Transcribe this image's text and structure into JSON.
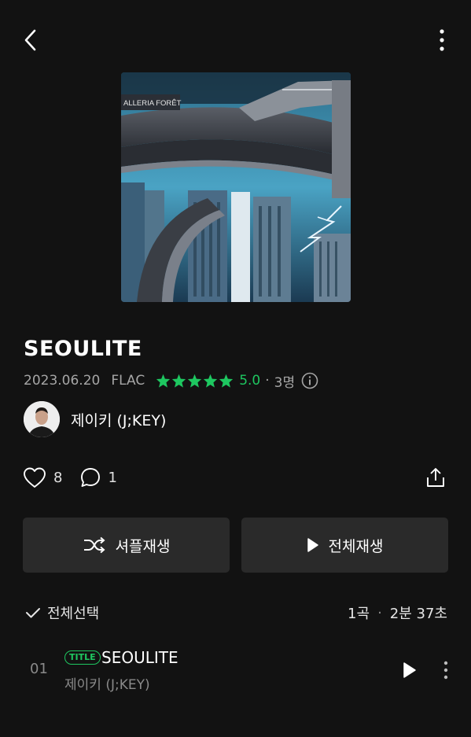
{
  "header": {
    "back_icon": "chevron-left-icon",
    "more_icon": "more-vertical-icon"
  },
  "album": {
    "title": "SEOULITE",
    "release_date": "2023.06.20",
    "format": "FLAC",
    "rating_stars": 5,
    "rating_score": "5.0",
    "rating_separator": "·",
    "rating_count": "3명",
    "cover_sign_text": "ALLERIA FORÊT"
  },
  "artist": {
    "name": "제이키 (J;KEY)"
  },
  "actions": {
    "likes": "8",
    "comments": "1",
    "share_icon": "share-icon"
  },
  "buttons": {
    "shuffle_label": "셔플재생",
    "play_all_label": "전체재생"
  },
  "list_header": {
    "select_all_label": "전체선택",
    "track_count": "1곡",
    "separator": "·",
    "total_duration": "2분 37초"
  },
  "tracks": [
    {
      "number": "01",
      "badge": "TITLE",
      "title": "SEOULITE",
      "artist": "제이키 (J;KEY)"
    }
  ],
  "colors": {
    "background": "#121212",
    "accent": "#1ec760",
    "button_bg": "#2a2a2a",
    "muted_text": "#8a8a8a"
  }
}
